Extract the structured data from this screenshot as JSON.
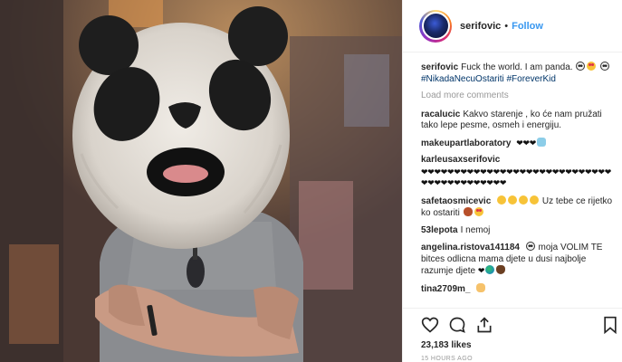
{
  "header": {
    "username": "serifovic",
    "dot": "•",
    "follow_label": "Follow"
  },
  "caption": {
    "username": "serifovic",
    "text": "Fuck the world. I am panda.",
    "hashtags": "#NikadaNecuOstariti #ForeverKid"
  },
  "load_more_label": "Load more comments",
  "comments": [
    {
      "username": "racalucic",
      "text": "Kakvo starenje , ko će nam pružati tako lepe pesme, osmeh i energiju."
    },
    {
      "username": "makeupartlaboratory",
      "text": ""
    },
    {
      "username": "karleusaxserifovic",
      "hearts": "❤❤❤❤❤❤❤❤❤❤❤❤❤❤❤❤❤❤❤❤❤❤❤❤❤❤❤❤❤❤❤❤❤❤❤❤❤❤❤❤❤❤"
    },
    {
      "username": "safetaosmicevic",
      "text": "Uz tebe ce rijetko ko ostariti"
    },
    {
      "username": "53lepota",
      "text": "I nemoj"
    },
    {
      "username": "angelina.ristova141184",
      "text": "moja VOLIM TE bitces odlicna mama djete u dusi najbolje razumje djete"
    },
    {
      "username": "tina2709m_",
      "text": ""
    }
  ],
  "icons": {
    "heart": "heart-outline-icon",
    "comment": "comment-bubble-icon",
    "share": "share-upload-icon",
    "save": "bookmark-icon"
  },
  "likes_label": "23,183 likes",
  "time_label": "15 HOURS AGO",
  "colors": {
    "link_blue": "#3897f0",
    "hashtag": "#003569",
    "muted": "#999999",
    "text": "#262626"
  }
}
